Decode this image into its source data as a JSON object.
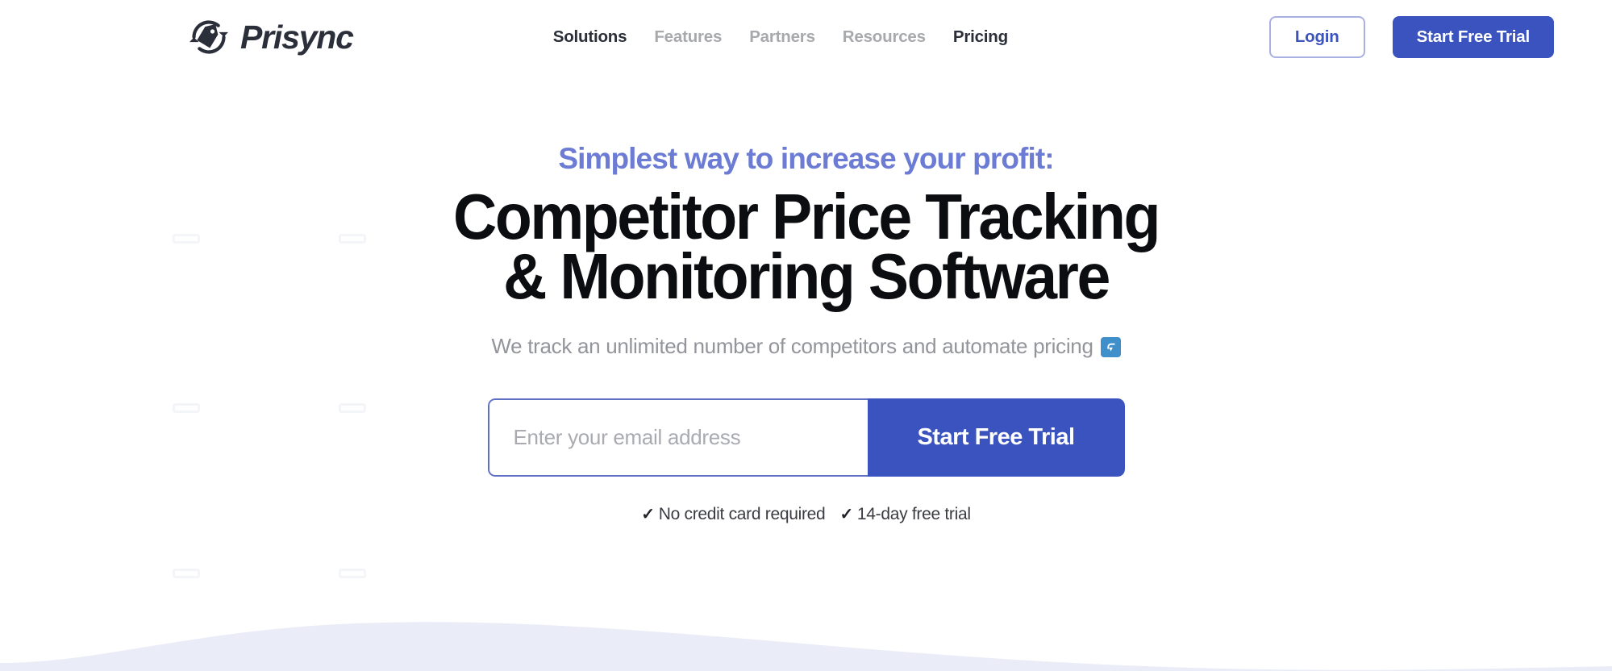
{
  "brand": {
    "name": "Prisync",
    "logo_icon": "sync-price-tag-icon"
  },
  "nav": {
    "items": [
      {
        "label": "Solutions",
        "active": true
      },
      {
        "label": "Features",
        "active": false
      },
      {
        "label": "Partners",
        "active": false
      },
      {
        "label": "Resources",
        "active": false
      },
      {
        "label": "Pricing",
        "active": true
      }
    ]
  },
  "header_actions": {
    "login_label": "Login",
    "trial_label": "Start Free Trial"
  },
  "hero": {
    "eyebrow": "Simplest way to increase your profit:",
    "title_line1": "Competitor Price Tracking",
    "title_line2": "& Monitoring Software",
    "subtitle": "We track an unlimited number of competitors and automate pricing",
    "subtitle_emoji": "arrow-heading-down-icon",
    "form": {
      "email_placeholder": "Enter your email address",
      "email_value": "",
      "submit_label": "Start Free Trial"
    },
    "notes": [
      {
        "check": "✓",
        "text": "No credit card required"
      },
      {
        "check": "✓",
        "text": "14-day free trial"
      }
    ]
  },
  "colors": {
    "brand_blue": "#3b53be",
    "eyebrow_periwinkle": "#6c7bd3",
    "login_border": "#a9b0e2",
    "nav_muted": "#a7a9ad",
    "nav_active": "#2b2f3a",
    "headline_black": "#0c0d10",
    "subtitle_gray": "#93959b",
    "emoji_blue": "#3f8fcb",
    "wave_lavender": "#eaecf7",
    "ghost_outline": "#f4f5f8"
  }
}
